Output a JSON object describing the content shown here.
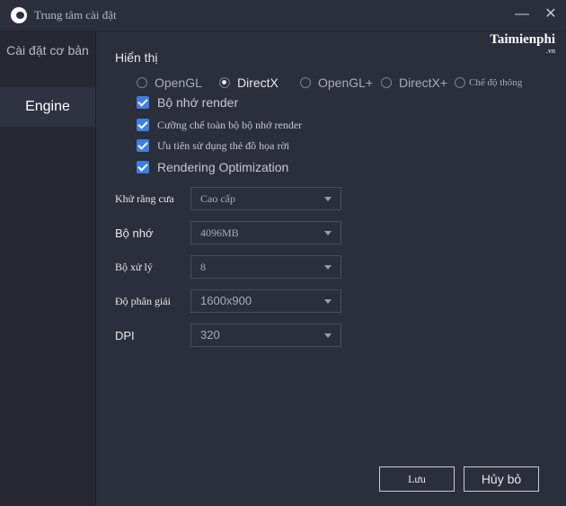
{
  "window": {
    "title": "Trung tâm cài đặt",
    "minimize_icon": "minimize-icon",
    "close_icon": "close-icon"
  },
  "watermark": {
    "text": "Taimienphi",
    "suffix": ".vn"
  },
  "sidebar": {
    "items": [
      {
        "label": "Cài đặt cơ bản",
        "active": false
      },
      {
        "label": "Engine",
        "active": true
      }
    ]
  },
  "display": {
    "title": "Hiển thị",
    "render_modes": [
      {
        "label": "OpenGL",
        "selected": false
      },
      {
        "label": "DirectX",
        "selected": true
      },
      {
        "label": "OpenGL+",
        "selected": false
      },
      {
        "label": "DirectX+",
        "selected": false
      },
      {
        "label": "Chế độ thông",
        "selected": false
      }
    ],
    "options": [
      {
        "label": "Bộ nhớ render",
        "checked": true
      },
      {
        "label": "Cưỡng chế toàn bộ bộ nhớ render",
        "checked": true
      },
      {
        "label": "Ưu tiên sử dụng thẻ đồ họa rời",
        "checked": true
      },
      {
        "label": "Rendering Optimization",
        "checked": true
      }
    ]
  },
  "fields": [
    {
      "label": "Khử răng cưa",
      "value": "Cao cấp"
    },
    {
      "label": "Bộ nhớ",
      "value": "4096MB"
    },
    {
      "label": "Bộ xử lý",
      "value": "8"
    },
    {
      "label": "Độ phân giải",
      "value": "1600x900"
    },
    {
      "label": "DPI",
      "value": "320"
    }
  ],
  "actions": {
    "save": "Lưu",
    "cancel": "Hủy bỏ"
  },
  "colors": {
    "background": "#2b2e3b",
    "sidebar": "#262834",
    "accent": "#3d7fe0"
  }
}
